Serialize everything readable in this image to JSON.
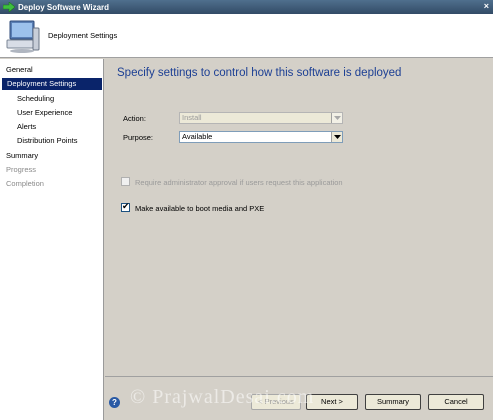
{
  "window": {
    "title": "Deploy Software Wizard"
  },
  "header": {
    "title": "Deployment Settings"
  },
  "sidebar": {
    "items": [
      {
        "label": "General"
      },
      {
        "label": "Deployment Settings"
      },
      {
        "label": "Scheduling"
      },
      {
        "label": "User Experience"
      },
      {
        "label": "Alerts"
      },
      {
        "label": "Distribution Points"
      },
      {
        "label": "Summary"
      },
      {
        "label": "Progress"
      },
      {
        "label": "Completion"
      }
    ]
  },
  "main": {
    "heading": "Specify settings to control how this software is deployed",
    "action": {
      "label": "Action:",
      "value": "Install"
    },
    "purpose": {
      "label": "Purpose:",
      "value": "Available"
    },
    "require_approval": {
      "label": "Require administrator approval if users request this application",
      "checked": false
    },
    "boot_media": {
      "label": "Make available to boot media and PXE",
      "checked": true
    }
  },
  "footer": {
    "previous": "< Previous",
    "next": "Next >",
    "summary": "Summary",
    "cancel": "Cancel"
  },
  "watermark": "© PrajwalDesai.com",
  "colors": {
    "selection": "#0a246a",
    "heading": "#1c3f94",
    "background": "#d4d0c8"
  }
}
